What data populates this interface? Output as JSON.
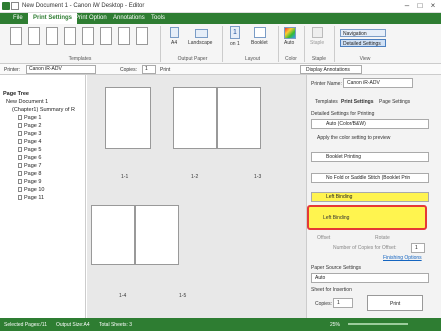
{
  "window": {
    "title": "New Document 1 - Canon iW Desktop - Editor"
  },
  "tabs": [
    "File",
    "Print Settings",
    "Print Option",
    "Annotations",
    "Tools"
  ],
  "ribbon": {
    "templates_label": "Templates",
    "output_paper_label": "Output Paper",
    "paper_size": "A4",
    "orientation": "Landscape",
    "layout_label": "Layout",
    "pages_per_sheet": "1",
    "pages_per_sheet_sub": "on 1",
    "booklet": "Booklet",
    "color_label": "Color",
    "color_mode": "Auto",
    "staple_label": "Staple",
    "staple": "Staple",
    "view_label": "View",
    "navigation": "Navigation",
    "detailed_settings": "Detailed Settings"
  },
  "toolbar": {
    "printer_label": "Printer:",
    "printer": "Canon iR-ADV",
    "copies_label": "Copies:",
    "copies": "1",
    "print_label": "Print",
    "display_annotations": "Display Annotations"
  },
  "tree": {
    "title": "Page Tree",
    "doc": "New Document 1",
    "chapter": "(Chapter1) Summary of R",
    "pages": [
      "Page 1",
      "Page 2",
      "Page 3",
      "Page 4",
      "Page 5",
      "Page 6",
      "Page 7",
      "Page 8",
      "Page 9",
      "Page 10",
      "Page 11"
    ]
  },
  "canvas": {
    "labels": [
      "1-1",
      "1-2",
      "1-3",
      "1-4",
      "1-5"
    ]
  },
  "panel": {
    "printer_name_label": "Printer Name:",
    "printer_name": "Canon iR-ADV",
    "tabs": [
      "Templates",
      "Print Settings",
      "Page Settings"
    ],
    "detailed_label": "Detailed Settings for Printing",
    "color": "Auto (Color/B&W)",
    "apply_color": "Apply the color setting to preview",
    "booklet": "Booklet Printing",
    "fold": "No Fold or Saddle Stitch (Booklet Prin",
    "binding1": "Left Binding",
    "binding2": "Left Binding",
    "offset": "Offset",
    "rotate": "Rotate",
    "copies_offset": "Number of Copies for Offset:",
    "copies_offset_val": "1",
    "finishing": "Finishing Options",
    "paper_source_label": "Paper Source Settings",
    "paper_source": "Auto",
    "sheet_insertion": "Sheet for Insertion",
    "copies_label": "Copies:",
    "copies": "1",
    "print_btn": "Print"
  },
  "status": {
    "selected": "Selected Pages:/11",
    "output_size": "Output Size:A4",
    "total_sheets": "Total Sheets: 3",
    "zoom": "25%"
  }
}
